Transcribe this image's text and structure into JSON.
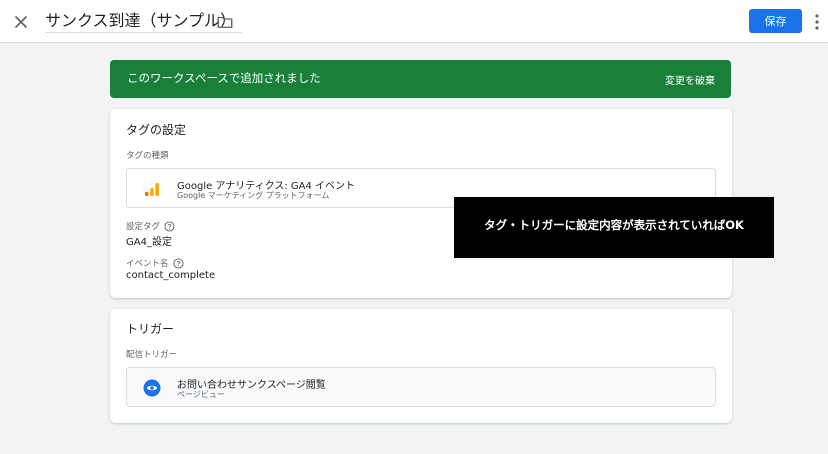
{
  "header": {
    "title": "サンクス到達（サンプル）",
    "save_label": "保存"
  },
  "banner": {
    "message": "このワークスペースで追加されました",
    "discard_label": "変更を破棄"
  },
  "tag_card": {
    "title": "タグの設定",
    "type_label": "タグの種類",
    "tag_type": {
      "name": "Google アナリティクス: GA4 イベント",
      "sub": "Google マーケティング プラットフォーム",
      "icon": "google-analytics-icon"
    },
    "config_tag_label": "設定タグ",
    "config_tag_value": "GA4_設定",
    "event_name_label": "イベント名",
    "event_name_value": "contact_complete"
  },
  "trigger_card": {
    "title": "トリガー",
    "firing_label": "配信トリガー",
    "trigger": {
      "name": "お問い合わせサンクスページ閲覧",
      "sub": "ページビュー",
      "icon": "eye-icon"
    }
  },
  "overlay": {
    "text": "タグ・トリガーに設定内容が表示されていればOK"
  },
  "colors": {
    "primary": "#1a73e8",
    "banner": "#188038",
    "analytics_orange": "#f9ab00",
    "analytics_dark": "#e37400"
  }
}
